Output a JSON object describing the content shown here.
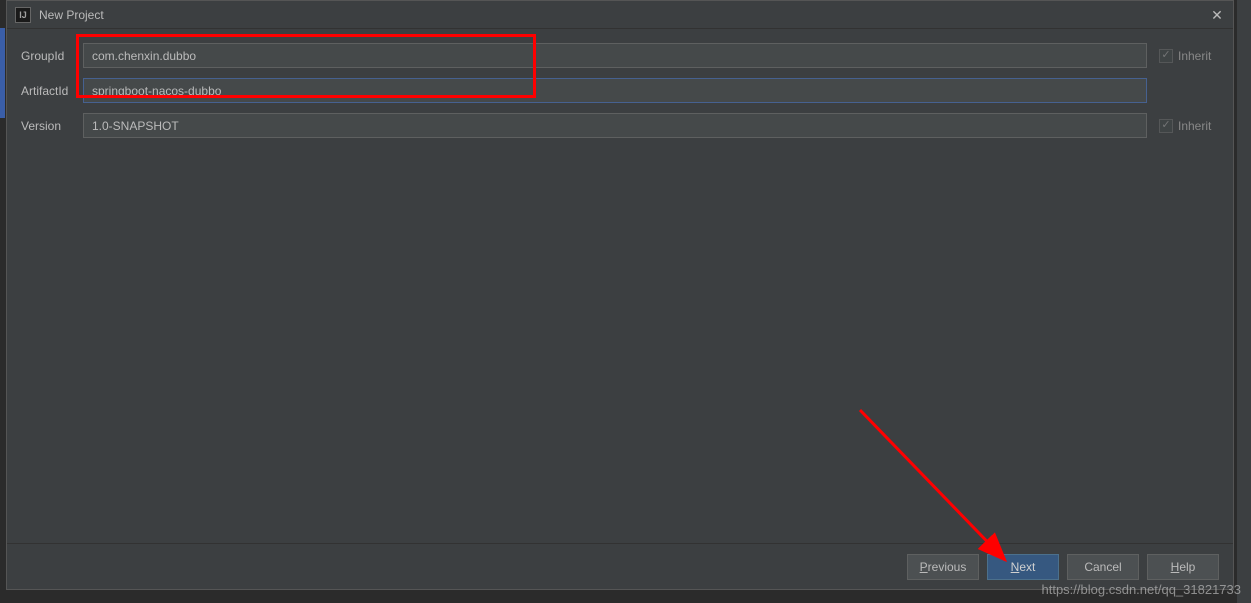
{
  "titlebar": {
    "icon_letter": "IJ",
    "title": "New Project"
  },
  "form": {
    "groupid_label": "GroupId",
    "groupid_value": "com.chenxin.dubbo",
    "artifactid_label": "ArtifactId",
    "artifactid_value": "springboot-nacos-dubbo",
    "version_label": "Version",
    "version_value": "1.0-SNAPSHOT",
    "inherit_label": "Inherit"
  },
  "footer": {
    "previous": "Previous",
    "next": "Next",
    "cancel": "Cancel",
    "help": "Help"
  },
  "watermark": "https://blog.csdn.net/qq_31821733"
}
